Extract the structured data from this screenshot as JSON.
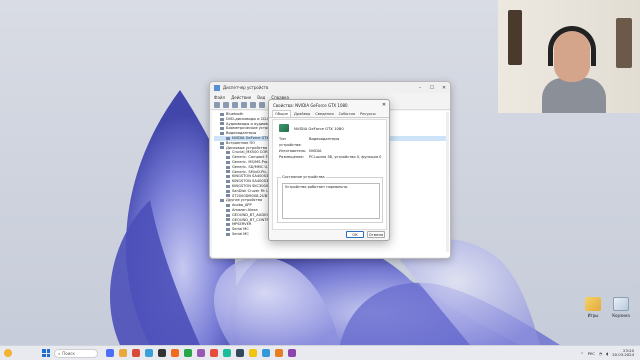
{
  "device_manager": {
    "title": "Диспетчер устройств",
    "menu": [
      "Файл",
      "Действие",
      "Вид",
      "Справка"
    ],
    "tree": [
      {
        "label": "Bluetooth",
        "indent": 1
      },
      {
        "label": "DVD-дисководы и CD-ROM",
        "indent": 1
      },
      {
        "label": "Аудиовходы и аудиовыходы",
        "indent": 1
      },
      {
        "label": "Биометрические устройства",
        "indent": 1
      },
      {
        "label": "Видеоадаптеры",
        "indent": 1
      },
      {
        "label": "NVIDIA GeForce GTX 1080",
        "indent": 2
      },
      {
        "label": "Встроенное ПО",
        "indent": 1
      },
      {
        "label": "Дисковые устройства",
        "indent": 1
      },
      {
        "label": "Crucial_MX500 CORE",
        "indent": 2
      },
      {
        "label": "Generic- Compact Fl...",
        "indent": 2
      },
      {
        "label": "Generic- MS/MS-Pro...",
        "indent": 2
      },
      {
        "label": "Generic- SD/MMC U...",
        "indent": 2
      },
      {
        "label": "Generic- SM/xD-Pic...",
        "indent": 2
      },
      {
        "label": "KINGSTON SA400S37",
        "indent": 2
      },
      {
        "label": "KINGSTON SA400S37",
        "indent": 2
      },
      {
        "label": "KINGSTON SKC3000",
        "indent": 2
      },
      {
        "label": "SanDisk Cruzer Fit USB",
        "indent": 2
      },
      {
        "label": "ST2000DM008-2UB10",
        "indent": 2
      },
      {
        "label": "Другие устройства",
        "indent": 1
      },
      {
        "label": "Acoba_APP",
        "indent": 2
      },
      {
        "label": "Amazon Alexa",
        "indent": 2
      },
      {
        "label": "GEOUND_BT_AUDIO",
        "indent": 2
      },
      {
        "label": "GEOUND_BT_CONTR...",
        "indent": 2
      },
      {
        "label": "MPSERVER",
        "indent": 2
      },
      {
        "label": "Serial MC",
        "indent": 2
      },
      {
        "label": "Serial MC",
        "indent": 2
      }
    ]
  },
  "properties": {
    "title": "Свойства: NVIDIA GeForce GTX 1080",
    "tabs": [
      "Общие",
      "Драйвер",
      "Сведения",
      "События",
      "Ресурсы"
    ],
    "device_name": "NVIDIA GeForce GTX 1080",
    "fields": [
      {
        "key": "Тип устройства:",
        "value": "Видеоадаптеры"
      },
      {
        "key": "Изготовитель:",
        "value": "NVIDIA"
      },
      {
        "key": "Размещение:",
        "value": "PCI-шина 38, устройство 0, функция 0"
      }
    ],
    "status_label": "Состояние устройства",
    "status_text": "Устройство работает нормально.",
    "ok_label": "ОК",
    "cancel_label": "Отмена"
  },
  "desktop": {
    "icons": [
      {
        "label": "Игры"
      },
      {
        "label": "Корзина"
      }
    ]
  },
  "taskbar": {
    "search_placeholder": "Поиск",
    "language": "РУС",
    "time": "23:20",
    "date": "20.03.2024"
  },
  "colors": {
    "accent": "#1f6fd1",
    "wallpaper_bloom": "#5b5fc7"
  }
}
